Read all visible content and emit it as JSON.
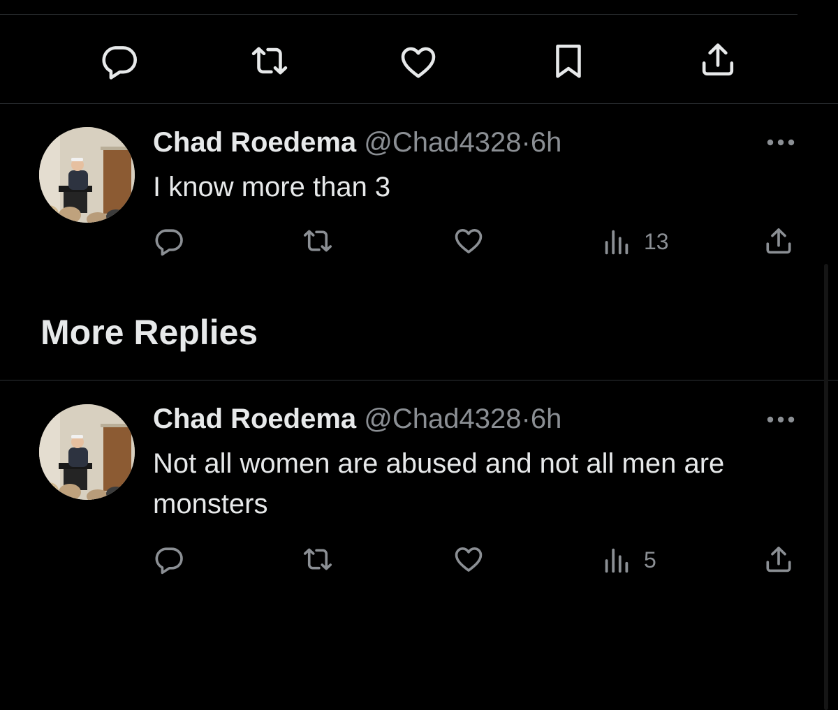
{
  "top_actions": {
    "icons": [
      "reply-icon",
      "retweet-icon",
      "like-icon",
      "bookmark-icon",
      "share-icon"
    ]
  },
  "more_replies": {
    "heading": "More Replies"
  },
  "replies": [
    {
      "author_name": "Chad Roedema",
      "author_handle": "@Chad4328",
      "separator": "·",
      "time": "6h",
      "text": "I know more than 3",
      "views": "13"
    },
    {
      "author_name": "Chad Roedema",
      "author_handle": "@Chad4328",
      "separator": "·",
      "time": "6h",
      "text": "Not all women are abused and not all men are monsters",
      "views": "5"
    }
  ],
  "colors": {
    "background": "#000000",
    "primary_text": "#e7e9ea",
    "secondary_text": "#8b8f94",
    "divider": "#2f3336"
  }
}
